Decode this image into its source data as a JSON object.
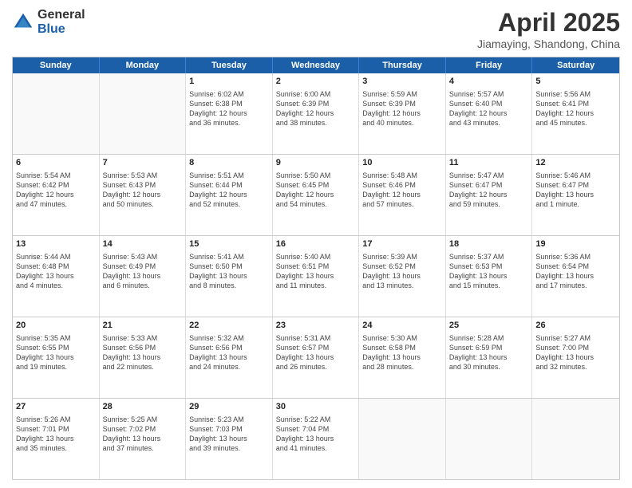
{
  "header": {
    "logo_general": "General",
    "logo_blue": "Blue",
    "title": "April 2025",
    "subtitle": "Jiamaying, Shandong, China"
  },
  "weekdays": [
    "Sunday",
    "Monday",
    "Tuesday",
    "Wednesday",
    "Thursday",
    "Friday",
    "Saturday"
  ],
  "weeks": [
    [
      {
        "day": "",
        "info": "",
        "empty": true
      },
      {
        "day": "",
        "info": "",
        "empty": true
      },
      {
        "day": "1",
        "info": "Sunrise: 6:02 AM\nSunset: 6:38 PM\nDaylight: 12 hours\nand 36 minutes."
      },
      {
        "day": "2",
        "info": "Sunrise: 6:00 AM\nSunset: 6:39 PM\nDaylight: 12 hours\nand 38 minutes."
      },
      {
        "day": "3",
        "info": "Sunrise: 5:59 AM\nSunset: 6:39 PM\nDaylight: 12 hours\nand 40 minutes."
      },
      {
        "day": "4",
        "info": "Sunrise: 5:57 AM\nSunset: 6:40 PM\nDaylight: 12 hours\nand 43 minutes."
      },
      {
        "day": "5",
        "info": "Sunrise: 5:56 AM\nSunset: 6:41 PM\nDaylight: 12 hours\nand 45 minutes."
      }
    ],
    [
      {
        "day": "6",
        "info": "Sunrise: 5:54 AM\nSunset: 6:42 PM\nDaylight: 12 hours\nand 47 minutes."
      },
      {
        "day": "7",
        "info": "Sunrise: 5:53 AM\nSunset: 6:43 PM\nDaylight: 12 hours\nand 50 minutes."
      },
      {
        "day": "8",
        "info": "Sunrise: 5:51 AM\nSunset: 6:44 PM\nDaylight: 12 hours\nand 52 minutes."
      },
      {
        "day": "9",
        "info": "Sunrise: 5:50 AM\nSunset: 6:45 PM\nDaylight: 12 hours\nand 54 minutes."
      },
      {
        "day": "10",
        "info": "Sunrise: 5:48 AM\nSunset: 6:46 PM\nDaylight: 12 hours\nand 57 minutes."
      },
      {
        "day": "11",
        "info": "Sunrise: 5:47 AM\nSunset: 6:47 PM\nDaylight: 12 hours\nand 59 minutes."
      },
      {
        "day": "12",
        "info": "Sunrise: 5:46 AM\nSunset: 6:47 PM\nDaylight: 13 hours\nand 1 minute."
      }
    ],
    [
      {
        "day": "13",
        "info": "Sunrise: 5:44 AM\nSunset: 6:48 PM\nDaylight: 13 hours\nand 4 minutes."
      },
      {
        "day": "14",
        "info": "Sunrise: 5:43 AM\nSunset: 6:49 PM\nDaylight: 13 hours\nand 6 minutes."
      },
      {
        "day": "15",
        "info": "Sunrise: 5:41 AM\nSunset: 6:50 PM\nDaylight: 13 hours\nand 8 minutes."
      },
      {
        "day": "16",
        "info": "Sunrise: 5:40 AM\nSunset: 6:51 PM\nDaylight: 13 hours\nand 11 minutes."
      },
      {
        "day": "17",
        "info": "Sunrise: 5:39 AM\nSunset: 6:52 PM\nDaylight: 13 hours\nand 13 minutes."
      },
      {
        "day": "18",
        "info": "Sunrise: 5:37 AM\nSunset: 6:53 PM\nDaylight: 13 hours\nand 15 minutes."
      },
      {
        "day": "19",
        "info": "Sunrise: 5:36 AM\nSunset: 6:54 PM\nDaylight: 13 hours\nand 17 minutes."
      }
    ],
    [
      {
        "day": "20",
        "info": "Sunrise: 5:35 AM\nSunset: 6:55 PM\nDaylight: 13 hours\nand 19 minutes."
      },
      {
        "day": "21",
        "info": "Sunrise: 5:33 AM\nSunset: 6:56 PM\nDaylight: 13 hours\nand 22 minutes."
      },
      {
        "day": "22",
        "info": "Sunrise: 5:32 AM\nSunset: 6:56 PM\nDaylight: 13 hours\nand 24 minutes."
      },
      {
        "day": "23",
        "info": "Sunrise: 5:31 AM\nSunset: 6:57 PM\nDaylight: 13 hours\nand 26 minutes."
      },
      {
        "day": "24",
        "info": "Sunrise: 5:30 AM\nSunset: 6:58 PM\nDaylight: 13 hours\nand 28 minutes."
      },
      {
        "day": "25",
        "info": "Sunrise: 5:28 AM\nSunset: 6:59 PM\nDaylight: 13 hours\nand 30 minutes."
      },
      {
        "day": "26",
        "info": "Sunrise: 5:27 AM\nSunset: 7:00 PM\nDaylight: 13 hours\nand 32 minutes."
      }
    ],
    [
      {
        "day": "27",
        "info": "Sunrise: 5:26 AM\nSunset: 7:01 PM\nDaylight: 13 hours\nand 35 minutes."
      },
      {
        "day": "28",
        "info": "Sunrise: 5:25 AM\nSunset: 7:02 PM\nDaylight: 13 hours\nand 37 minutes."
      },
      {
        "day": "29",
        "info": "Sunrise: 5:23 AM\nSunset: 7:03 PM\nDaylight: 13 hours\nand 39 minutes."
      },
      {
        "day": "30",
        "info": "Sunrise: 5:22 AM\nSunset: 7:04 PM\nDaylight: 13 hours\nand 41 minutes."
      },
      {
        "day": "",
        "info": "",
        "empty": true
      },
      {
        "day": "",
        "info": "",
        "empty": true
      },
      {
        "day": "",
        "info": "",
        "empty": true
      }
    ]
  ]
}
